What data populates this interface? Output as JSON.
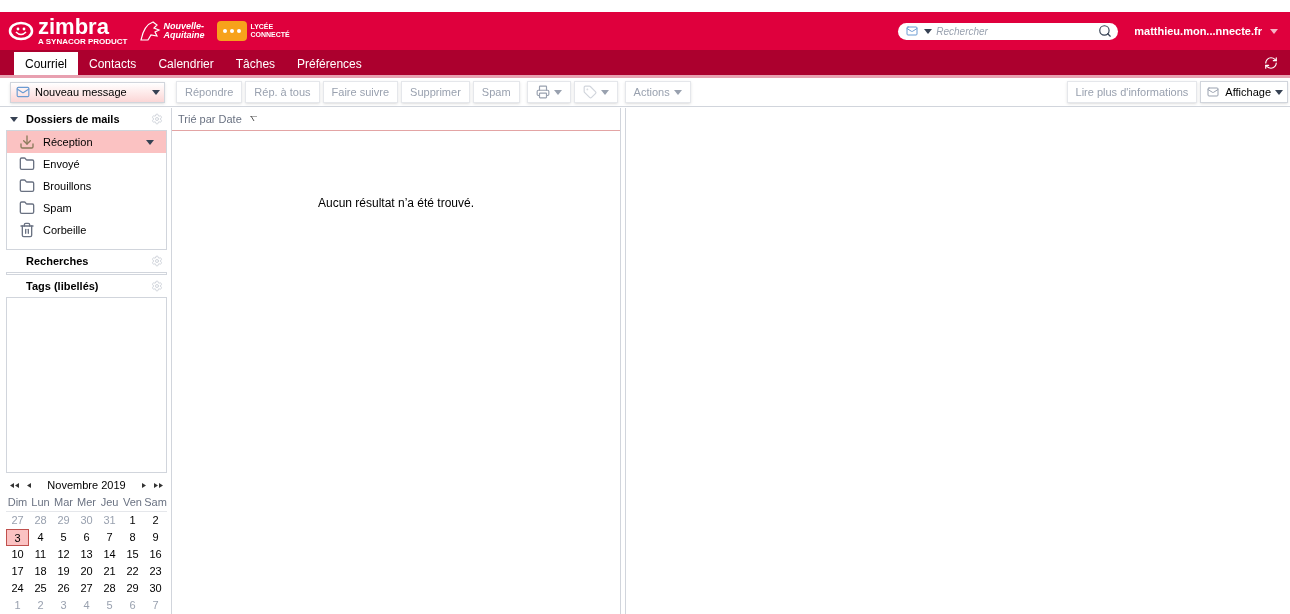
{
  "header": {
    "logo": {
      "name": "zimbra",
      "tagline": "A SYNACOR PRODUCT"
    },
    "region_logo": [
      "Nouvelle-",
      "Aquitaine"
    ],
    "school_logo": [
      "LYCÉE",
      "CONNECTÉ"
    ],
    "search": {
      "placeholder": "Rechercher"
    },
    "user": "matthieu.mon...nnecte.fr"
  },
  "tabs": [
    {
      "label": "Courriel",
      "selected": true
    },
    {
      "label": "Contacts",
      "selected": false
    },
    {
      "label": "Calendrier",
      "selected": false
    },
    {
      "label": "Tâches",
      "selected": false
    },
    {
      "label": "Préférences",
      "selected": false
    }
  ],
  "toolbar": {
    "new_message": "Nouveau message",
    "buttons": [
      {
        "kind": "text",
        "label": "Répondre"
      },
      {
        "kind": "text",
        "label": "Rép. à tous"
      },
      {
        "kind": "text",
        "label": "Faire suivre"
      },
      {
        "kind": "text",
        "label": "Supprimer"
      },
      {
        "kind": "text",
        "label": "Spam"
      },
      {
        "kind": "print"
      },
      {
        "kind": "tag"
      },
      {
        "kind": "menu",
        "label": "Actions"
      }
    ],
    "read_more": "Lire plus d'informations",
    "view": "Affichage"
  },
  "sidebar": {
    "sections": [
      {
        "title": "Dossiers de mails",
        "expanded": true,
        "folders": [
          {
            "kind": "inbox",
            "label": "Réception",
            "selected": true
          },
          {
            "kind": "sent",
            "label": "Envoyé",
            "selected": false
          },
          {
            "kind": "drafts",
            "label": "Brouillons",
            "selected": false
          },
          {
            "kind": "spam",
            "label": "Spam",
            "selected": false
          },
          {
            "kind": "trash",
            "label": "Corbeille",
            "selected": false
          }
        ]
      },
      {
        "title": "Recherches",
        "expanded": false
      },
      {
        "title": "Tags (libellés)",
        "expanded": false
      }
    ],
    "calendar": {
      "month": "Novembre 2019",
      "weekdays": [
        "Dim",
        "Lun",
        "Mar",
        "Mer",
        "Jeu",
        "Ven",
        "Sam"
      ],
      "weeks": [
        [
          {
            "day": "27",
            "muted": true,
            "selected": false
          },
          {
            "day": "28",
            "muted": true,
            "selected": false
          },
          {
            "day": "29",
            "muted": true,
            "selected": false
          },
          {
            "day": "30",
            "muted": true,
            "selected": false
          },
          {
            "day": "31",
            "muted": true,
            "selected": false
          },
          {
            "day": "1",
            "muted": false,
            "selected": false
          },
          {
            "day": "2",
            "muted": false,
            "selected": false
          }
        ],
        [
          {
            "day": "3",
            "muted": false,
            "selected": true
          },
          {
            "day": "4",
            "muted": false,
            "selected": false
          },
          {
            "day": "5",
            "muted": false,
            "selected": false
          },
          {
            "day": "6",
            "muted": false,
            "selected": false
          },
          {
            "day": "7",
            "muted": false,
            "selected": false
          },
          {
            "day": "8",
            "muted": false,
            "selected": false
          },
          {
            "day": "9",
            "muted": false,
            "selected": false
          }
        ],
        [
          {
            "day": "10",
            "muted": false,
            "selected": false
          },
          {
            "day": "11",
            "muted": false,
            "selected": false
          },
          {
            "day": "12",
            "muted": false,
            "selected": false
          },
          {
            "day": "13",
            "muted": false,
            "selected": false
          },
          {
            "day": "14",
            "muted": false,
            "selected": false
          },
          {
            "day": "15",
            "muted": false,
            "selected": false
          },
          {
            "day": "16",
            "muted": false,
            "selected": false
          }
        ],
        [
          {
            "day": "17",
            "muted": false,
            "selected": false
          },
          {
            "day": "18",
            "muted": false,
            "selected": false
          },
          {
            "day": "19",
            "muted": false,
            "selected": false
          },
          {
            "day": "20",
            "muted": false,
            "selected": false
          },
          {
            "day": "21",
            "muted": false,
            "selected": false
          },
          {
            "day": "22",
            "muted": false,
            "selected": false
          },
          {
            "day": "23",
            "muted": false,
            "selected": false
          }
        ],
        [
          {
            "day": "24",
            "muted": false,
            "selected": false
          },
          {
            "day": "25",
            "muted": false,
            "selected": false
          },
          {
            "day": "26",
            "muted": false,
            "selected": false
          },
          {
            "day": "27",
            "muted": false,
            "selected": false
          },
          {
            "day": "28",
            "muted": false,
            "selected": false
          },
          {
            "day": "29",
            "muted": false,
            "selected": false
          },
          {
            "day": "30",
            "muted": false,
            "selected": false
          }
        ],
        [
          {
            "day": "1",
            "muted": true,
            "selected": false
          },
          {
            "day": "2",
            "muted": true,
            "selected": false
          },
          {
            "day": "3",
            "muted": true,
            "selected": false
          },
          {
            "day": "4",
            "muted": true,
            "selected": false
          },
          {
            "day": "5",
            "muted": true,
            "selected": false
          },
          {
            "day": "6",
            "muted": true,
            "selected": false
          },
          {
            "day": "7",
            "muted": true,
            "selected": false
          }
        ]
      ]
    }
  },
  "message_list": {
    "sort_label": "Trié par Date",
    "empty_message": "Aucun résultat n’a été trouvé."
  }
}
